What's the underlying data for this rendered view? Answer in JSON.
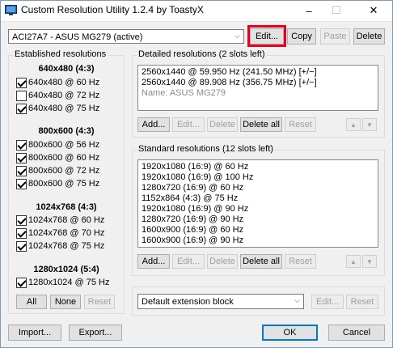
{
  "window": {
    "title": "Custom Resolution Utility 1.2.4 by ToastyX",
    "minimize": "–",
    "maximize": "☐",
    "close": "✕"
  },
  "top": {
    "monitor_select": "ACI27A7 - ASUS MG279 (active)",
    "edit": "Edit...",
    "copy": "Copy",
    "paste": "Paste",
    "delete": "Delete"
  },
  "established": {
    "title": "Established resolutions",
    "groups": [
      {
        "header": "640x480 (4:3)",
        "items": [
          {
            "label": "640x480 @ 60 Hz",
            "checked": true
          },
          {
            "label": "640x480 @ 72 Hz",
            "checked": false
          },
          {
            "label": "640x480 @ 75 Hz",
            "checked": true
          }
        ]
      },
      {
        "header": "800x600 (4:3)",
        "items": [
          {
            "label": "800x600 @ 56 Hz",
            "checked": true
          },
          {
            "label": "800x600 @ 60 Hz",
            "checked": true
          },
          {
            "label": "800x600 @ 72 Hz",
            "checked": true
          },
          {
            "label": "800x600 @ 75 Hz",
            "checked": true
          }
        ]
      },
      {
        "header": "1024x768 (4:3)",
        "items": [
          {
            "label": "1024x768 @ 60 Hz",
            "checked": true
          },
          {
            "label": "1024x768 @ 70 Hz",
            "checked": true
          },
          {
            "label": "1024x768 @ 75 Hz",
            "checked": true
          }
        ]
      },
      {
        "header": "1280x1024 (5:4)",
        "items": [
          {
            "label": "1280x1024 @ 75 Hz",
            "checked": true
          }
        ]
      }
    ],
    "all": "All",
    "none": "None",
    "reset": "Reset"
  },
  "detailed": {
    "title": "Detailed resolutions (2 slots left)",
    "lines": [
      "2560x1440 @ 59.950 Hz (241.50 MHz) [+/−]",
      "2560x1440 @ 89.908 Hz (356.75 MHz) [+/−]"
    ],
    "name_line": "Name: ASUS MG279",
    "add": "Add...",
    "edit": "Edit...",
    "delete": "Delete",
    "delete_all": "Delete all",
    "reset": "Reset"
  },
  "standard": {
    "title": "Standard resolutions (12 slots left)",
    "lines": [
      "1920x1080 (16:9) @ 60 Hz",
      "1920x1080 (16:9) @ 100 Hz",
      "1280x720 (16:9) @ 60 Hz",
      "1152x864 (4:3) @ 75 Hz",
      "1920x1080 (16:9) @ 90 Hz",
      "1280x720 (16:9) @ 90 Hz",
      "1600x900 (16:9) @ 60 Hz",
      "1600x900 (16:9) @ 90 Hz"
    ],
    "add": "Add...",
    "edit": "Edit...",
    "delete": "Delete",
    "delete_all": "Delete all",
    "reset": "Reset"
  },
  "extension": {
    "select": "Default extension block",
    "edit": "Edit...",
    "reset": "Reset"
  },
  "bottom": {
    "import": "Import...",
    "export": "Export...",
    "ok": "OK",
    "cancel": "Cancel"
  },
  "colors": {
    "highlight": "#e8001c",
    "accent": "#0078d7"
  }
}
